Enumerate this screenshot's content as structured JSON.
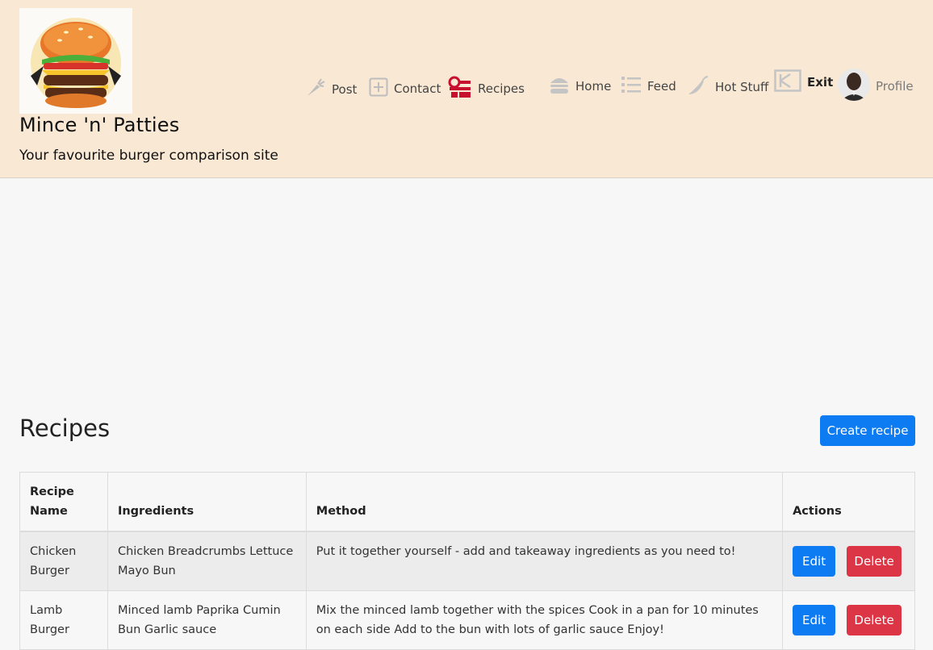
{
  "site": {
    "title": "Mince 'n' Patties",
    "tagline": "Your favourite burger comparison site"
  },
  "nav": [
    {
      "label": "Post",
      "icon": "carrot-icon"
    },
    {
      "label": "Contact",
      "icon": "plus-square-icon"
    },
    {
      "label": "Recipes",
      "icon": "recipes-icon"
    },
    {
      "label": "Home",
      "icon": "burger-icon"
    },
    {
      "label": "Feed",
      "icon": "list-icon"
    },
    {
      "label": "Hot Stuff",
      "icon": "chili-icon"
    },
    {
      "label": "Exit",
      "icon": "exit-icon"
    },
    {
      "label": "Profile",
      "icon": "avatar"
    }
  ],
  "page": {
    "title": "Recipes",
    "create_label": "Create recipe"
  },
  "table": {
    "headers": {
      "name": "Recipe Name",
      "ingredients": "Ingredients",
      "method": "Method",
      "actions": "Actions"
    },
    "rows": [
      {
        "name": "Chicken Burger",
        "ingredients": "Chicken Breadcrumbs Lettuce Mayo Bun",
        "method": "Put it together yourself - add and takeaway ingredients as you need to!",
        "edit": "Edit",
        "delete": "Delete"
      },
      {
        "name": "Lamb Burger",
        "ingredients": "Minced lamb Paprika Cumin Bun Garlic sauce",
        "method": "Mix the minced lamb together with the spices Cook in a pan for 10 minutes on each side Add to the bun with lots of garlic sauce Enjoy!",
        "edit": "Edit",
        "delete": "Delete"
      }
    ]
  },
  "colors": {
    "header_bg": "#f8e8d4",
    "primary": "#0d7cf2",
    "danger": "#dc3545",
    "recipes_icon": "#c8102e"
  }
}
